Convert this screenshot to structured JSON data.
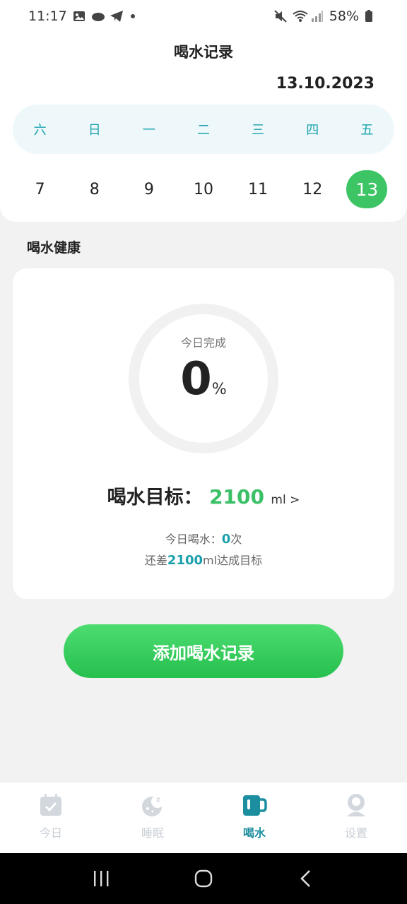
{
  "status_bar": {
    "time": "11:17",
    "battery": "58%"
  },
  "header": {
    "title": "喝水记录",
    "date": "13.10.2023"
  },
  "calendar": {
    "weekdays": [
      "六",
      "日",
      "一",
      "二",
      "三",
      "四",
      "五"
    ],
    "days": [
      "7",
      "8",
      "9",
      "10",
      "11",
      "12",
      "13"
    ],
    "selected_day": "13"
  },
  "section": {
    "title": "喝水健康"
  },
  "progress": {
    "label": "今日完成",
    "value": "0",
    "unit": "%",
    "percent": 0
  },
  "goal": {
    "label": "喝水目标：",
    "value": "2100",
    "unit": "ml >"
  },
  "today": {
    "prefix": "今日喝水：",
    "count": "0",
    "suffix": "次"
  },
  "remaining": {
    "prefix": "还差",
    "amount": "2100",
    "suffix": "ml达成目标"
  },
  "add_button": {
    "label": "添加喝水记录"
  },
  "bottom_nav": {
    "items": [
      {
        "label": "今日",
        "icon": "calendar-check-icon"
      },
      {
        "label": "睡眠",
        "icon": "moon-sleep-icon"
      },
      {
        "label": "喝水",
        "icon": "cup-icon"
      },
      {
        "label": "设置",
        "icon": "user-icon"
      }
    ],
    "active_index": 2
  },
  "colors": {
    "accent_green": "#3dc565",
    "accent_teal": "#1c8ea0",
    "weekday_bg": "#eef8fa"
  }
}
